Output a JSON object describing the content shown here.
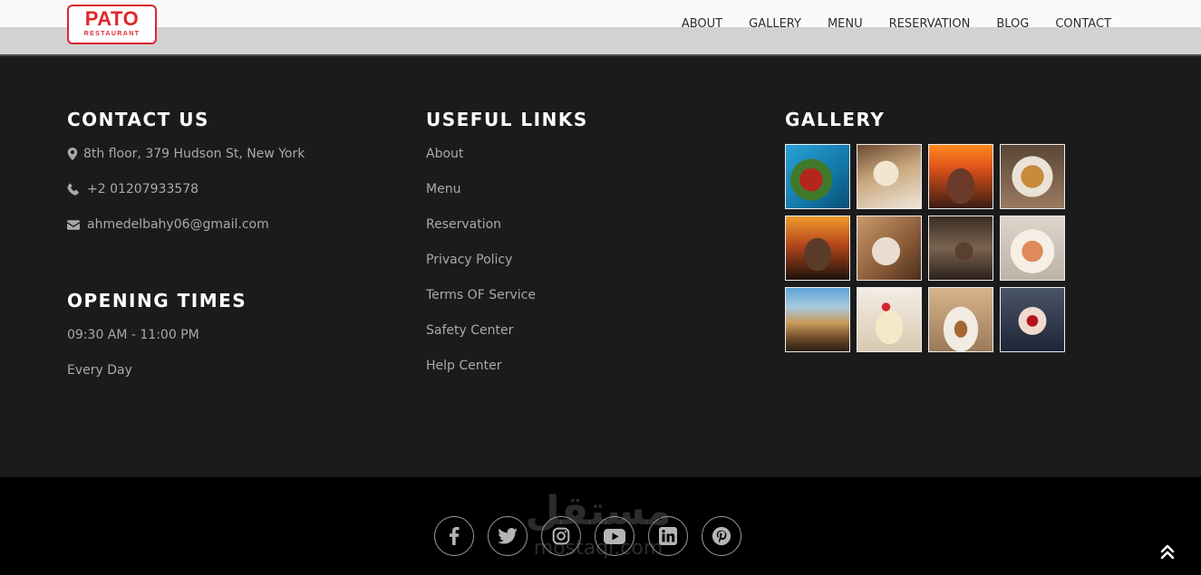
{
  "brand": {
    "name": "PATO",
    "tagline": "RESTAURANT",
    "accent": "#e0272d"
  },
  "nav": {
    "items": [
      "ABOUT",
      "GALLERY",
      "MENU",
      "RESERVATION",
      "BLOG",
      "CONTACT"
    ]
  },
  "contact": {
    "heading": "CONTACT US",
    "address": {
      "icon": "map-marker-icon",
      "text": "8th floor, 379 Hudson St, New York"
    },
    "phone": {
      "icon": "phone-icon",
      "text": "+2 01207933578"
    },
    "email": {
      "icon": "envelope-icon",
      "text": "ahmedelbahy06@gmail.com"
    }
  },
  "opening": {
    "heading": "OPENING TIMES",
    "hours": "09:30 AM - 11:00 PM",
    "days": "Every Day"
  },
  "links": {
    "heading": "USEFUL LINKS",
    "items": [
      "About",
      "Menu",
      "Reservation",
      "Privacy Policy",
      "Terms OF Service",
      "Safety Center",
      "Help Center"
    ]
  },
  "gallery": {
    "heading": "GALLERY",
    "images": [
      "salad-on-blue-table",
      "bread-and-coffee",
      "grilled-steak-flames",
      "fish-fillet",
      "roast-chicken-fire",
      "dining-plates",
      "restaurant-kitchen-staff",
      "shrimp-dish",
      "city-street-evening",
      "dessert-with-cherry",
      "plated-dish",
      "red-fruit-in-hands"
    ]
  },
  "footer": {
    "social": [
      "facebook-icon",
      "twitter-icon",
      "instagram-icon",
      "youtube-icon",
      "linkedin-icon",
      "pinterest-icon"
    ],
    "watermark_ar": "مستقل",
    "watermark_en": "mostaql.com"
  },
  "colors": {
    "footer_bg": "#1b1b1b",
    "bottom_bg": "#000000",
    "heading": "#ffffff",
    "text": "#a9a9a9"
  }
}
